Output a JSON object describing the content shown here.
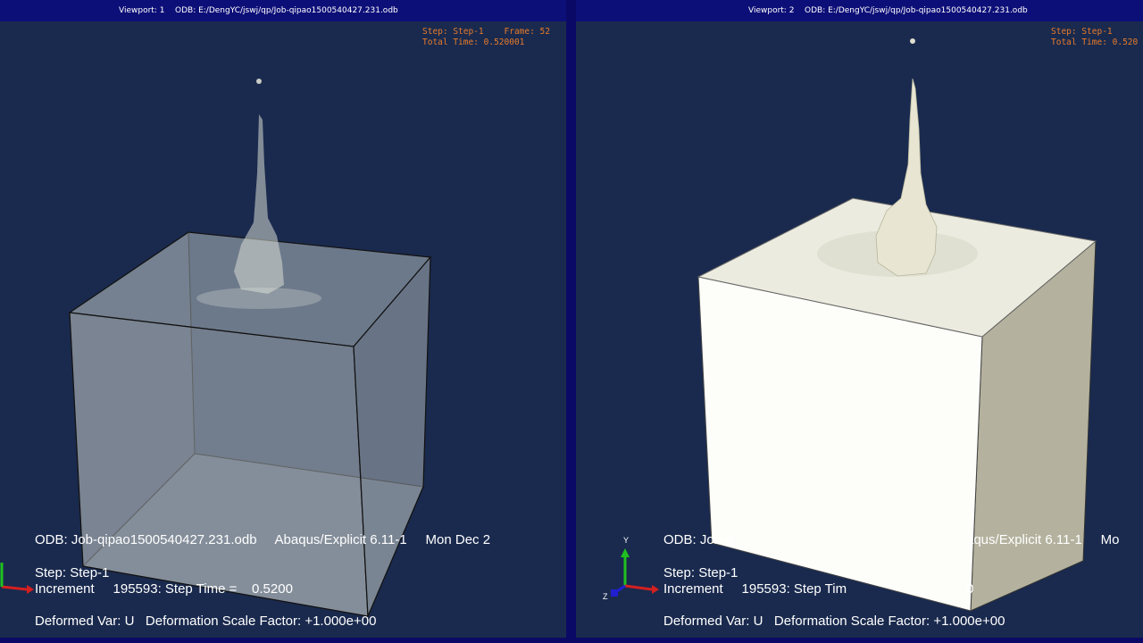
{
  "viewport1": {
    "title": "Viewport: 1",
    "odb_path": "ODB: E:/DengYC/jswj/qp/Job-qipao1500540427.231.odb",
    "step_line": "Step: Step-1    Frame: 52",
    "time_line": "Total Time: 0.520001",
    "odb_line": "ODB: Job-qipao1500540427.231.odb     Abaqus/Explicit 6.11-1     Mon Dec 2",
    "step_label": "Step: Step-1",
    "increment_line": "Increment     195593: Step Time =    0.5200",
    "deformed_line": "Deformed Var: U   Deformation Scale Factor: +1.000e+00"
  },
  "viewport2": {
    "title": "Viewport: 2",
    "odb_path": "ODB: E:/DengYC/jswj/qp/Job-qipao1500540427.231.odb",
    "step_line": "Step: Step-1",
    "time_line": "Total Time: 0.520",
    "odb_line": "ODB: Job-q",
    "odb_line_right": "aqus/Explicit 6.11-1     Mo",
    "step_label": "Step: Step-1",
    "increment_line": "Increment     195593: Step Tim",
    "increment_tail": "0",
    "deformed_line": "Deformed Var: U   Deformation Scale Factor: +1.000e+00",
    "triad": {
      "y": "Y",
      "z": "Z"
    }
  },
  "colors": {
    "background": "#1a2a4e",
    "titlebar": "#0d0f78",
    "step_text": "#e87b2a",
    "axis_x": "#d42020",
    "axis_y": "#20c020",
    "axis_z": "#2020d0"
  }
}
